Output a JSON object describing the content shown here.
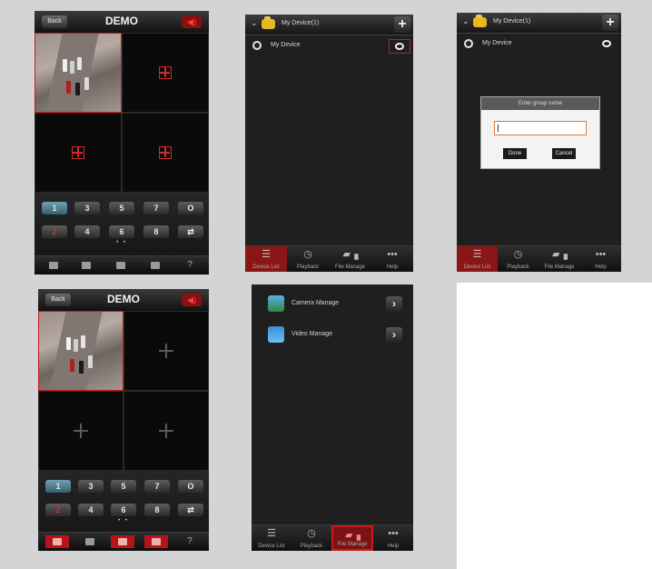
{
  "colors": {
    "background": "#d2d4d6",
    "screen": "#1f1f1f",
    "accent_red": "#c81a1a"
  },
  "live_view": {
    "back_label": "Back",
    "title": "DEMO",
    "audio_icon": "speaker-icon",
    "keys_row1": [
      "1",
      "3",
      "5",
      "7",
      "O"
    ],
    "keys_row2": [
      "2",
      "4",
      "6",
      "8",
      "⇄"
    ],
    "page_dots": "• •",
    "toolbar_icons": [
      "record-icon",
      "capture-icon",
      "camera-icon",
      "folder-icon",
      "help-icon"
    ],
    "help_label": "?"
  },
  "device_list": {
    "group_name": "My Device(1)",
    "device_name": "My Device",
    "add_label": "+"
  },
  "dialog": {
    "title": "Enter group name",
    "done_label": "Done",
    "cancel_label": "Cancel"
  },
  "tabs": {
    "device_list": "Device List",
    "playback": "Playback",
    "file_manage": "File Manage",
    "help": "Help"
  },
  "file_manage": {
    "items": [
      {
        "label": "Camera Manage",
        "icon": "image-icon"
      },
      {
        "label": "Video Manage",
        "icon": "video-icon"
      }
    ]
  }
}
